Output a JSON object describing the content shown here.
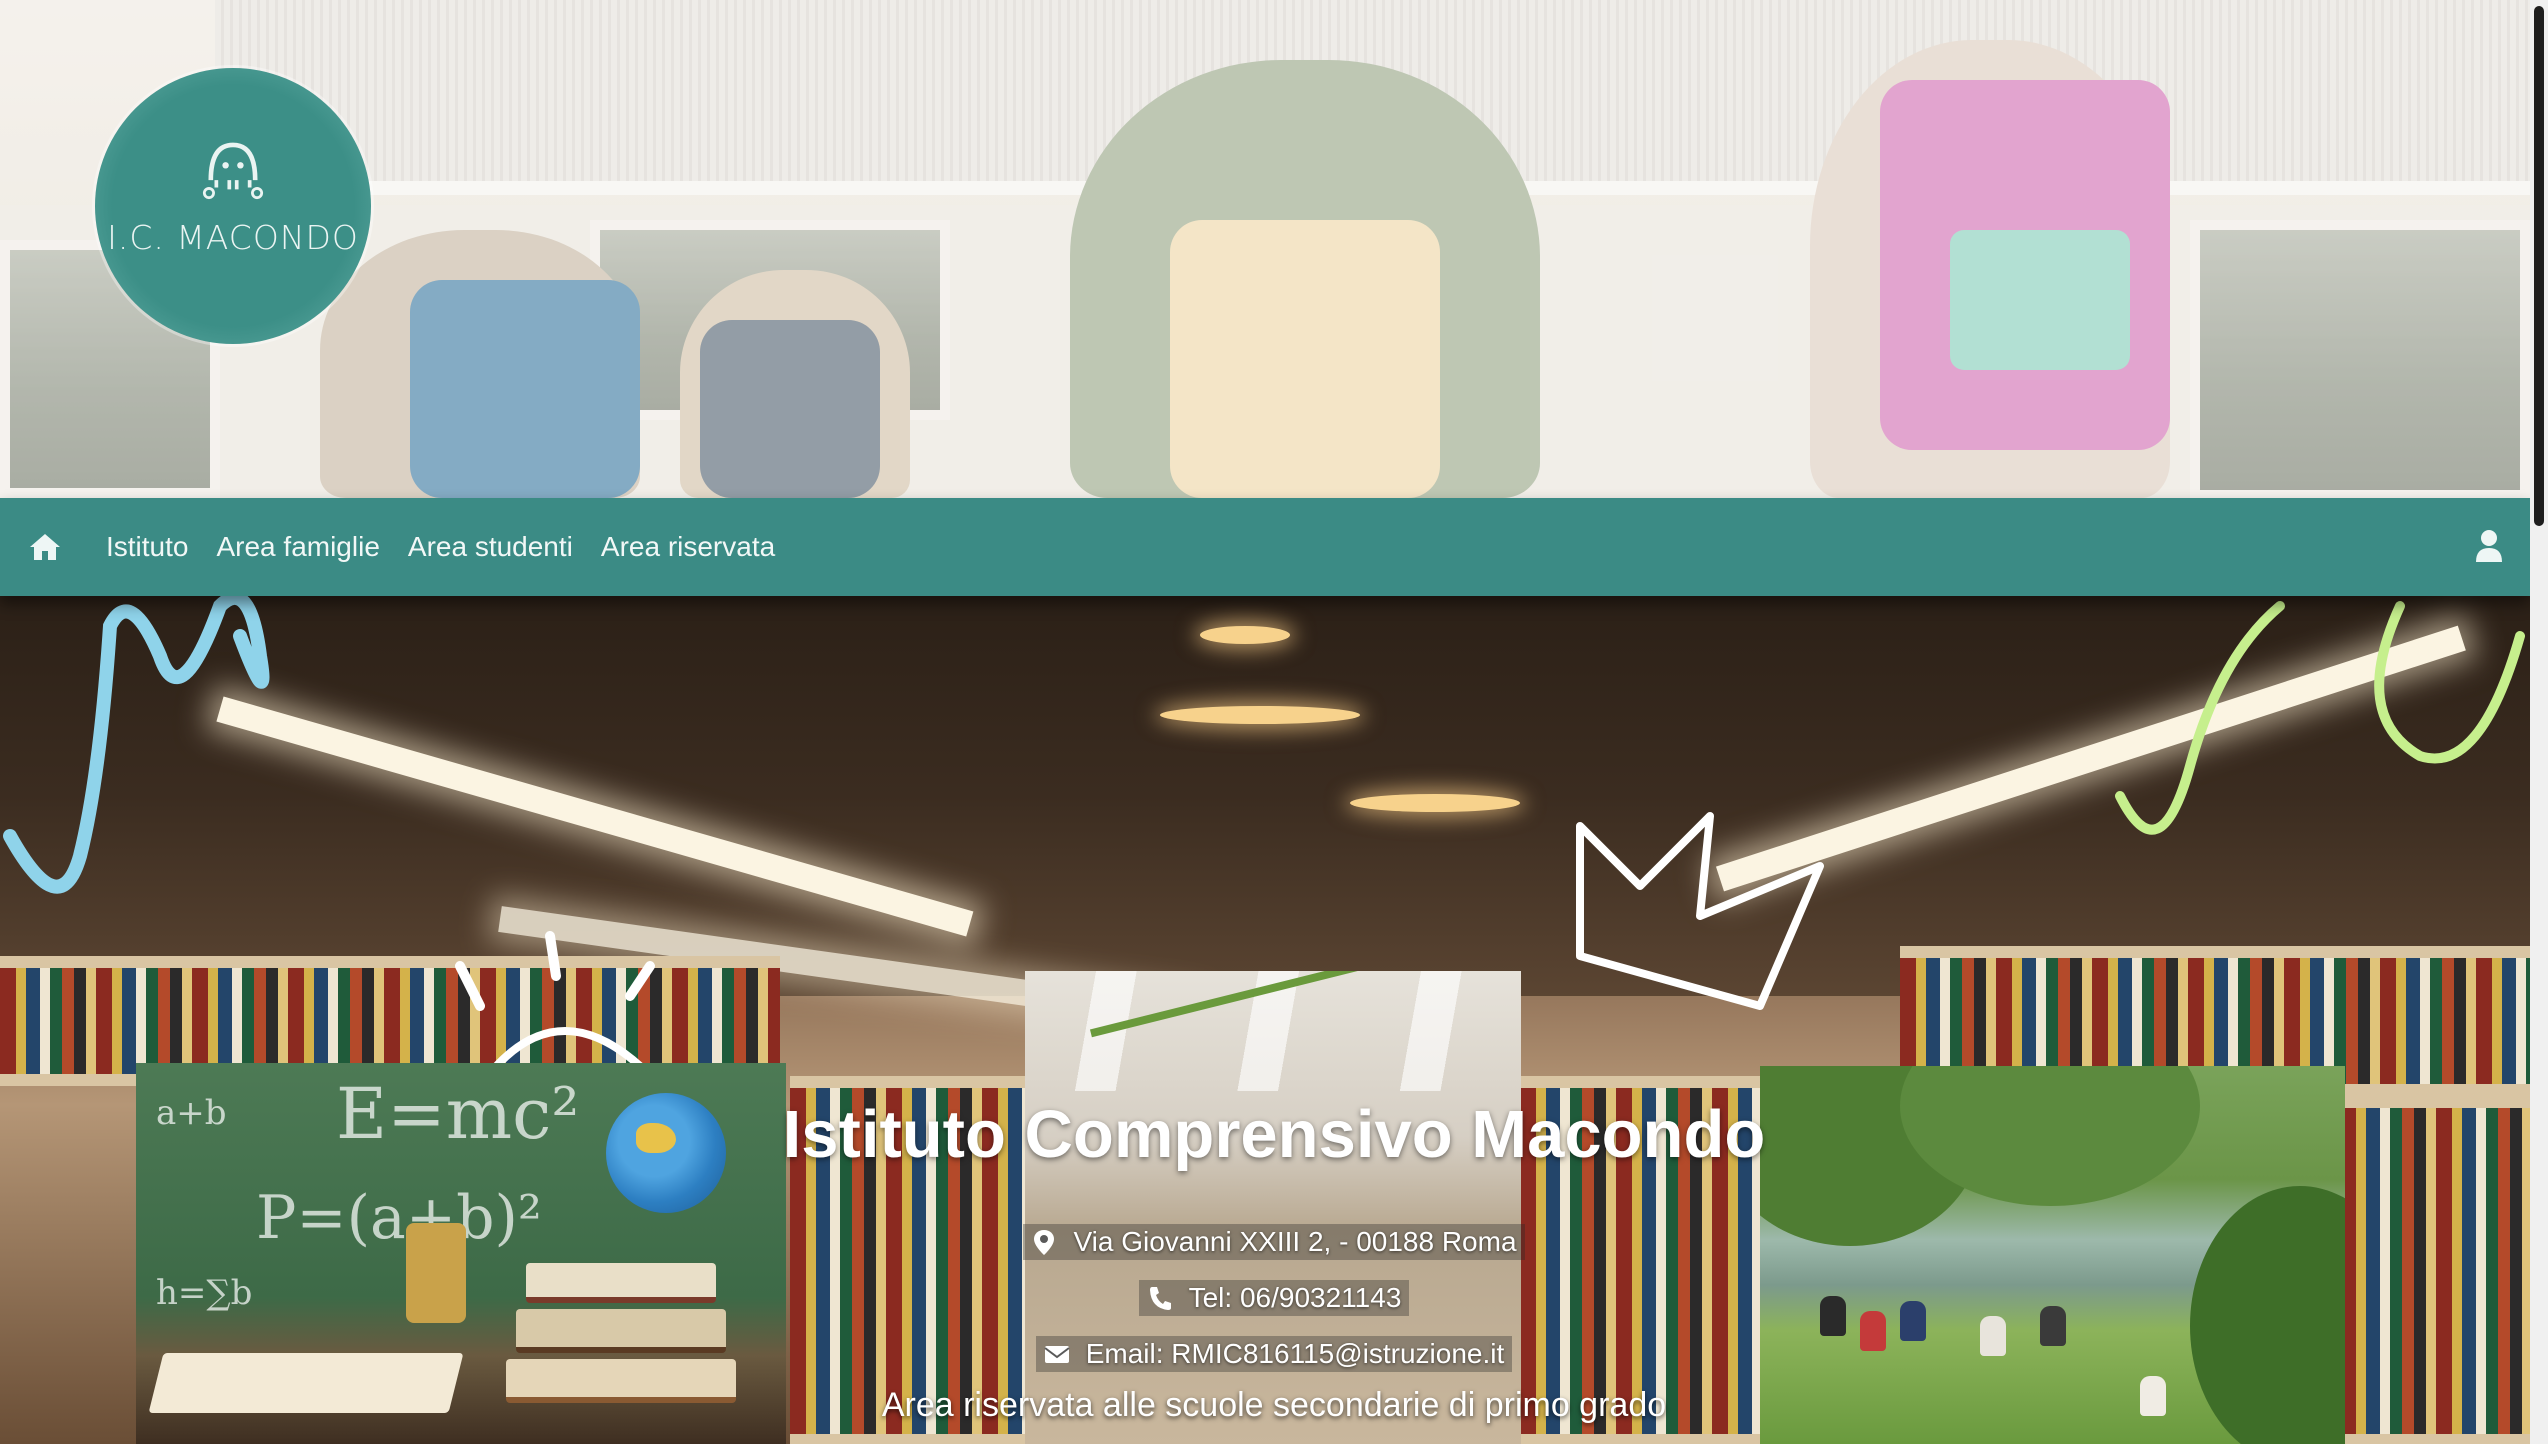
{
  "logo": {
    "text": "I.C. MACONDO"
  },
  "nav": {
    "home_icon": "home-icon",
    "items": [
      {
        "label": "Istituto"
      },
      {
        "label": "Area famiglie"
      },
      {
        "label": "Area studenti"
      },
      {
        "label": "Area riservata"
      }
    ],
    "user_icon": "user-icon"
  },
  "hero": {
    "title": "Istituto Comprensivo Macondo",
    "address": "Via Giovanni XXIII 2, - 00188 Roma",
    "phone": "Tel: 06/90321143",
    "email": "Email: RMIC816115@istruzione.it",
    "subtitle": "Area riservata alle scuole secondarie di primo grado"
  },
  "colors": {
    "brand_teal": "#3b8b85",
    "logo_teal": "#3c8f87",
    "white": "#ffffff"
  }
}
